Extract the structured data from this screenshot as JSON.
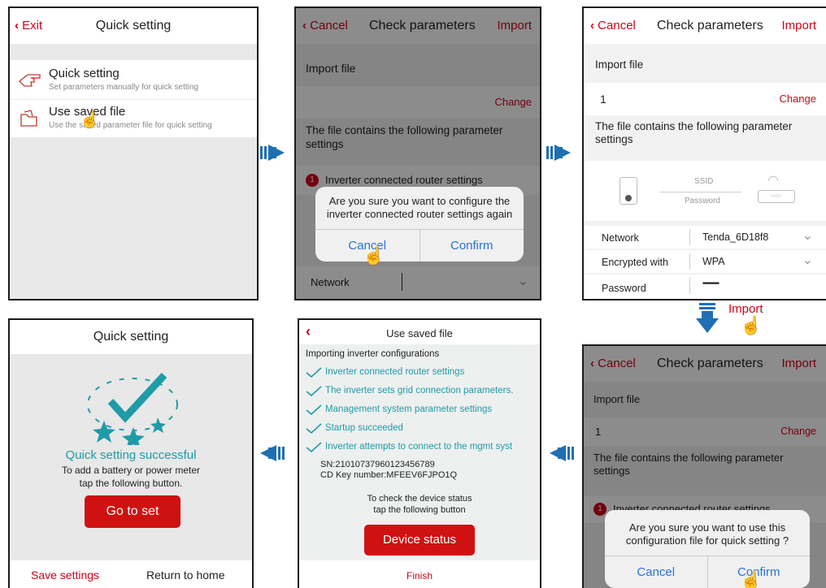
{
  "screen1": {
    "exit_label": "Exit",
    "title": "Quick setting",
    "item1_title": "Quick setting",
    "item1_desc": "Set parameters manually for quick setting",
    "item2_title": "Use saved file",
    "item2_desc": "Use the saved parameter file for quick setting"
  },
  "screen2": {
    "cancel_label": "Cancel",
    "title": "Check parameters",
    "import_label": "Import",
    "import_file_label": "Import file",
    "change_label": "Change",
    "contains_text": "The file contains the following parameter settings",
    "section_number": "1",
    "section_label": "Inverter connected router settings",
    "network_label": "Network",
    "dialog_message": "Are you sure you want to configure the inverter connected router settings again",
    "dialog_cancel": "Cancel",
    "dialog_confirm": "Confirm"
  },
  "screen3": {
    "cancel_label": "Cancel",
    "title": "Check parameters",
    "import_label": "Import",
    "import_file_label": "Import file",
    "file_value": "1",
    "change_label": "Change",
    "contains_text": "The file contains the following parameter settings",
    "ssid_label": "SSID",
    "password_hint": "Password",
    "network_label": "Network",
    "network_value": "Tenda_6D18f8",
    "encrypted_label": "Encrypted with",
    "encrypted_value": "WPA",
    "password_label": "Password",
    "password_value": "••••••••"
  },
  "import_action_label": "Import",
  "screen4": {
    "cancel_label": "Cancel",
    "title": "Check parameters",
    "import_label": "Import",
    "import_file_label": "Import file",
    "file_value": "1",
    "change_label": "Change",
    "contains_text": "The file contains the following parameter settings",
    "section_number": "1",
    "section_label": "Inverter connected router settings",
    "dialog_message": "Are you sure you want to use this configuration file for quick setting ?",
    "dialog_cancel": "Cancel",
    "dialog_confirm": "Confirm"
  },
  "screen5": {
    "title": "Use saved file",
    "importing_text": "Importing inverter configurations",
    "items": [
      "Inverter connected router settings",
      "The inverter sets grid connection parameters.",
      "Management system parameter settings",
      "Startup succeeded",
      "Inverter attempts to connect to the mgmt syst"
    ],
    "sn": "SN:21010737960123456789",
    "cd_key": "CD Key number:MFEEV6FJPO1Q",
    "check_line1": "To check the device status",
    "check_line2": "tap the following button",
    "device_status_label": "Device status",
    "finish_label": "Finish"
  },
  "screen6": {
    "title": "Quick setting",
    "success_text": "Quick setting successful",
    "line1": "To add a battery or power meter",
    "line2": "tap the following button.",
    "go_to_set_label": "Go to set",
    "save_settings_label": "Save settings",
    "return_home_label": "Return to home"
  },
  "colors": {
    "accent_red": "#d0021b",
    "button_red": "#cf1111",
    "link_blue": "#2a73d6",
    "teal": "#1f9ba8",
    "arrow_blue": "#1f6fb2"
  }
}
